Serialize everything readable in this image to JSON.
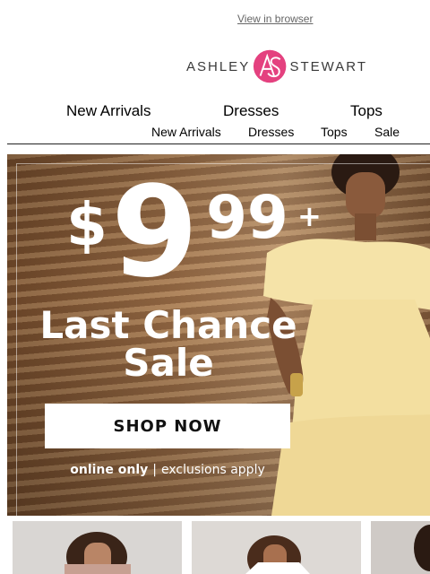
{
  "header": {
    "view_in_browser": "View in browser",
    "logo": {
      "left_text": "ASHLEY",
      "right_text": "STEWART",
      "monogram": "AS"
    }
  },
  "nav_primary": [
    {
      "label": "New Arrivals"
    },
    {
      "label": "Dresses"
    },
    {
      "label": "Tops"
    }
  ],
  "nav_secondary": [
    {
      "label": "New Arrivals"
    },
    {
      "label": "Dresses"
    },
    {
      "label": "Tops"
    },
    {
      "label": "Sale"
    }
  ],
  "hero": {
    "price_symbol": "$",
    "price_main": "9",
    "price_cents": "99",
    "price_plus": "+",
    "headline_line1": "Last Chance",
    "headline_line2": "Sale",
    "cta": "SHOP NOW",
    "fine_bold": "online only",
    "fine_sep": "|",
    "fine_rest": "exclusions apply"
  },
  "colors": {
    "brand_pink": "#e4417f",
    "hero_warm": "#a97a51",
    "dress_yellow": "#f5e3a8"
  }
}
